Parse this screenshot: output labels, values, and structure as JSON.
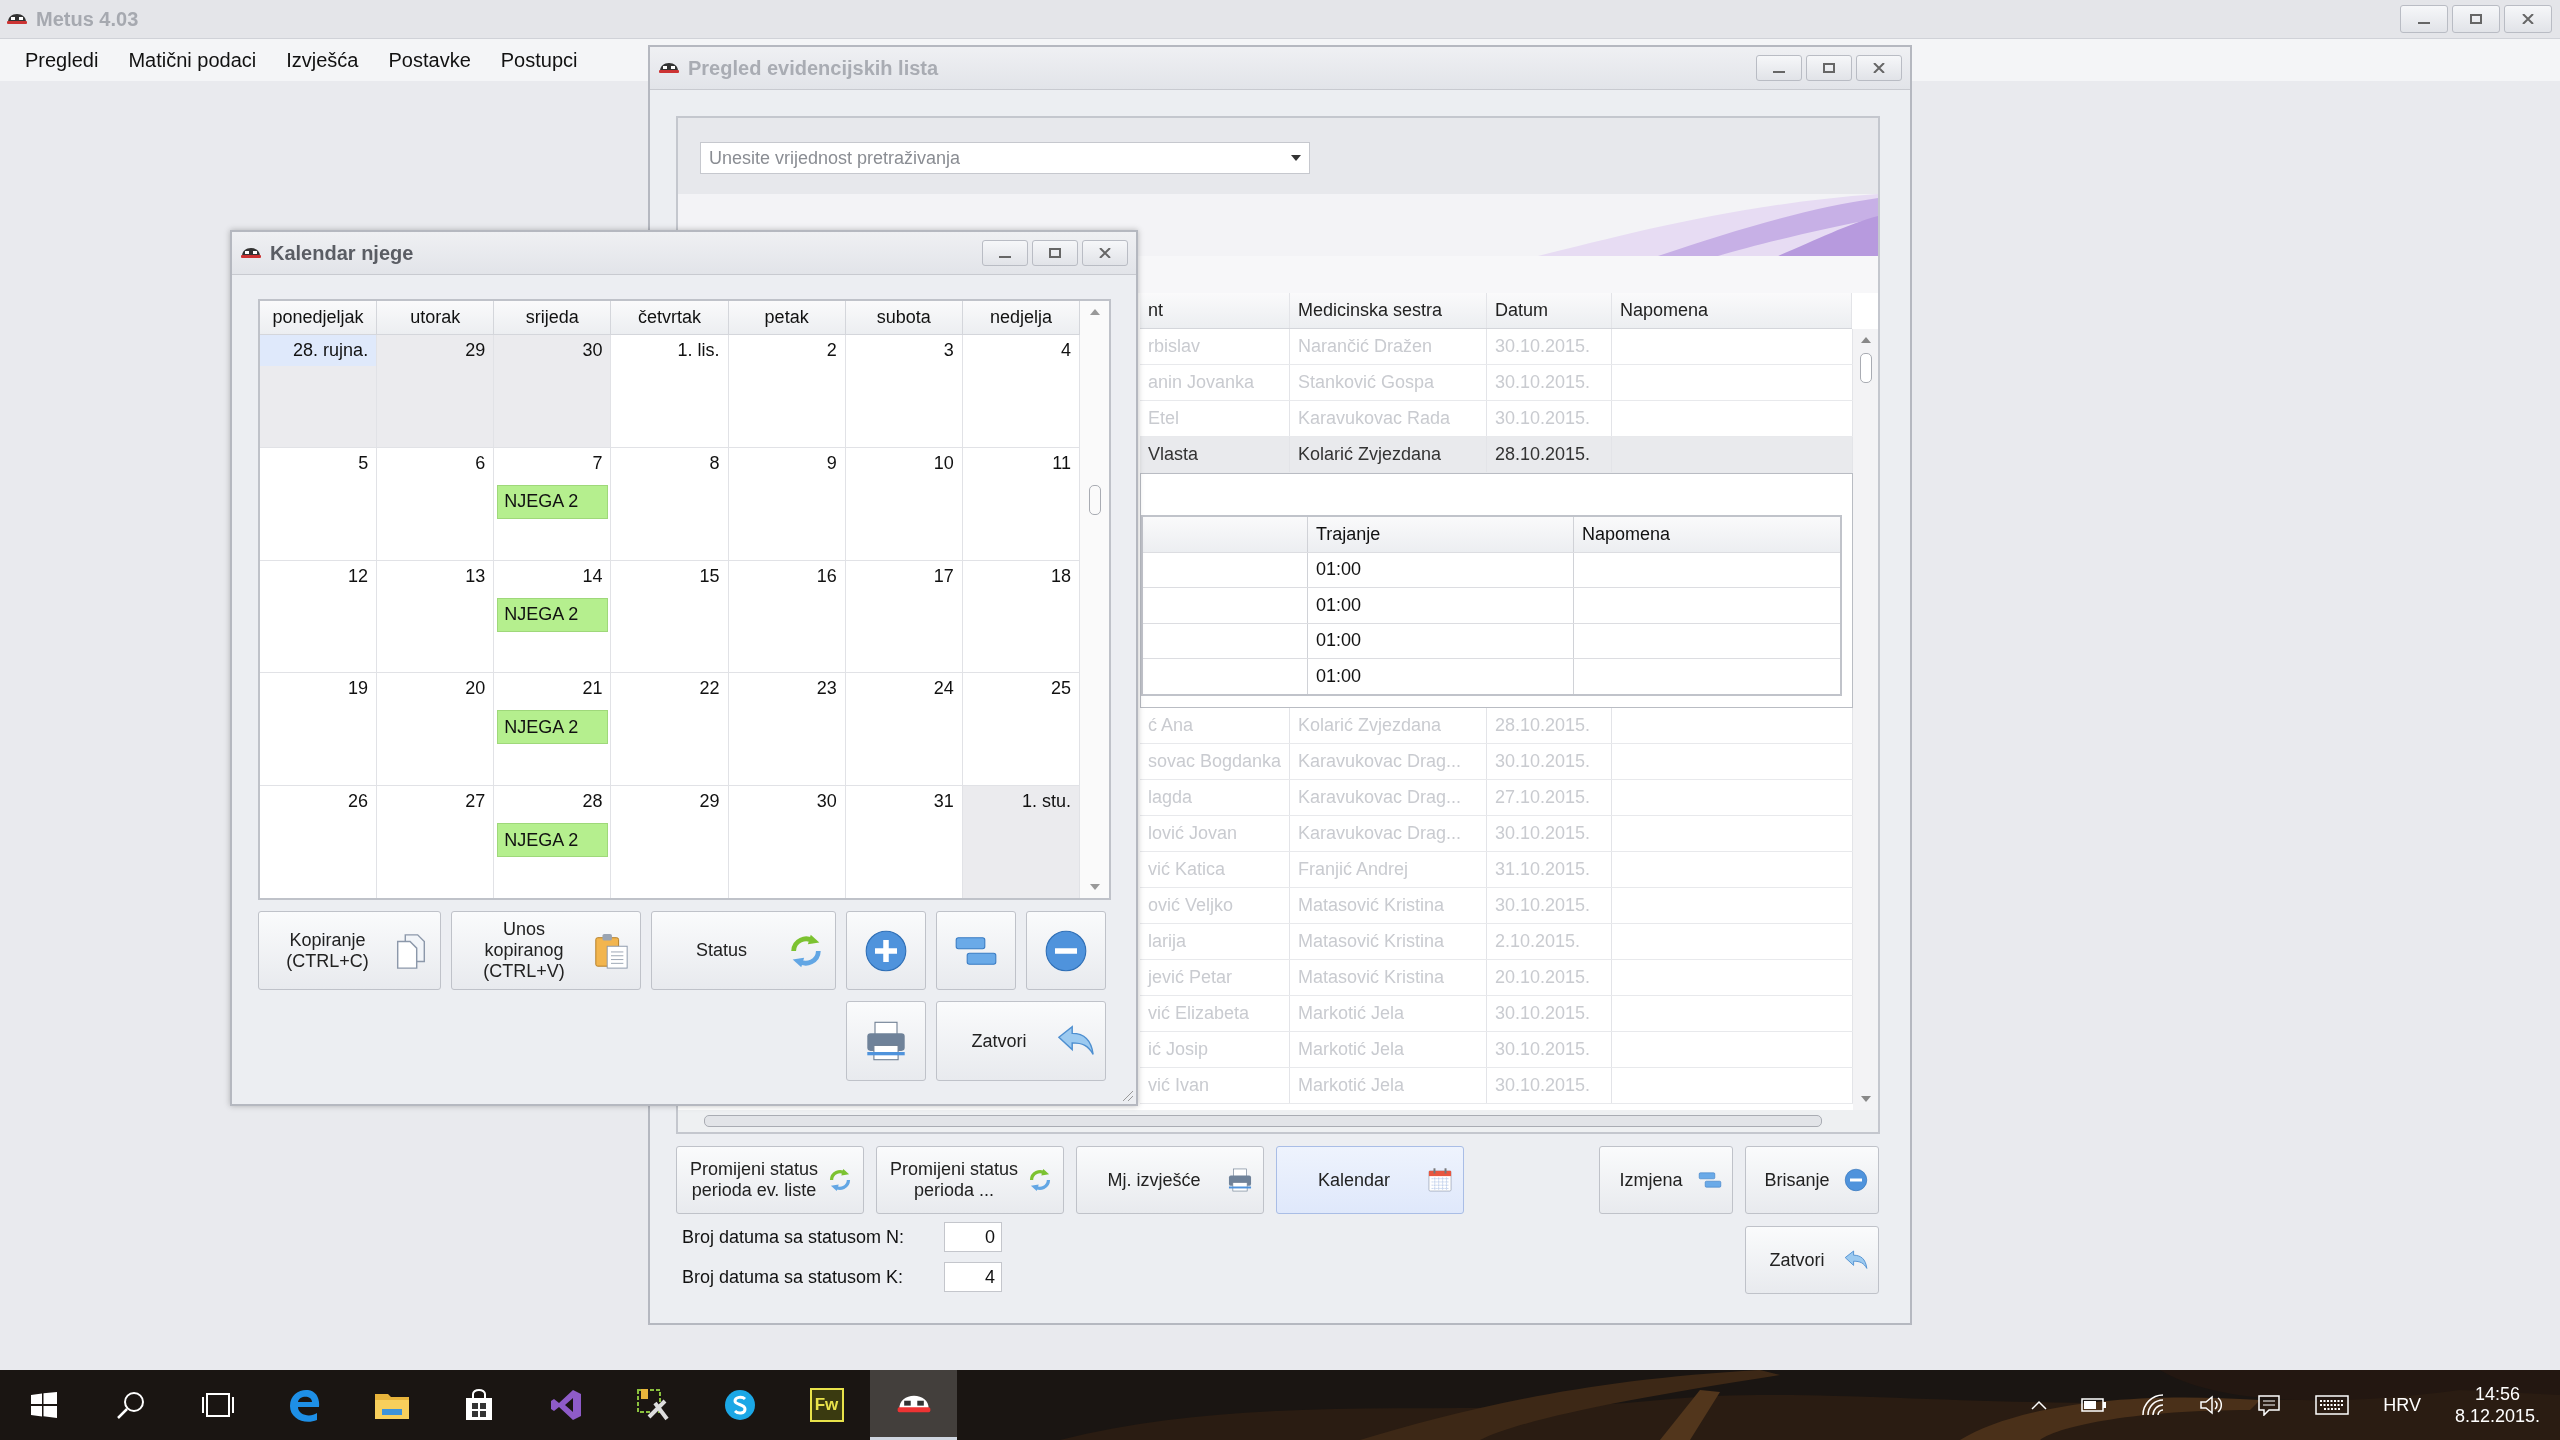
{
  "app": {
    "title": "Metus 4.03",
    "menu": [
      "Pregledi",
      "Matični podaci",
      "Izvješća",
      "Postavke",
      "Postupci"
    ]
  },
  "evidence_window": {
    "title": "Pregled evidencijskih lista",
    "search": {
      "placeholder": "Unesite vrijednost pretraživanja"
    },
    "table": {
      "columns": [
        "nt",
        "Medicinska sestra",
        "Datum",
        "Napomena"
      ],
      "rows": [
        {
          "patient": "rbislav",
          "nurse": "Narančić Dražen",
          "date": "30.10.2015.",
          "selected": false
        },
        {
          "patient": "anin Jovanka",
          "nurse": "Stanković Gospa",
          "date": "30.10.2015.",
          "selected": false
        },
        {
          "patient": "Etel",
          "nurse": "Karavukovac Rada",
          "date": "30.10.2015.",
          "selected": false
        },
        {
          "patient": "Vlasta",
          "nurse": "Kolarić Zvjezdana",
          "date": "28.10.2015.",
          "selected": true,
          "detail": {
            "columns": [
              "Trajanje",
              "Napomena"
            ],
            "rows": [
              {
                "duration": "01:00"
              },
              {
                "duration": "01:00"
              },
              {
                "duration": "01:00"
              },
              {
                "duration": "01:00"
              }
            ]
          }
        },
        {
          "patient": "ć Ana",
          "nurse": "Kolarić Zvjezdana",
          "date": "28.10.2015.",
          "selected": false
        },
        {
          "patient": "sovac Bogdanka",
          "nurse": "Karavukovac Drag...",
          "date": "30.10.2015.",
          "selected": false
        },
        {
          "patient": "lagda",
          "nurse": "Karavukovac Drag...",
          "date": "27.10.2015.",
          "selected": false
        },
        {
          "patient": "lović Jovan",
          "nurse": "Karavukovac Drag...",
          "date": "30.10.2015.",
          "selected": false
        },
        {
          "patient": "vić Katica",
          "nurse": "Franjić Andrej",
          "date": "31.10.2015.",
          "selected": false
        },
        {
          "patient": "ović Veljko",
          "nurse": "Matasović Kristina",
          "date": "30.10.2015.",
          "selected": false
        },
        {
          "patient": "larija",
          "nurse": "Matasović Kristina",
          "date": "2.10.2015.",
          "selected": false
        },
        {
          "patient": "jević Petar",
          "nurse": "Matasović Kristina",
          "date": "20.10.2015.",
          "selected": false
        },
        {
          "patient": "vić Elizabeta",
          "nurse": "Markotić Jela",
          "date": "30.10.2015.",
          "selected": false
        },
        {
          "patient": "ić Josip",
          "nurse": "Markotić Jela",
          "date": "30.10.2015.",
          "selected": false
        },
        {
          "patient": "vić Ivan",
          "nurse": "Markotić Jela",
          "date": "30.10.2015.",
          "selected": false
        }
      ]
    },
    "buttons": [
      {
        "label": "Promijeni status\nperioda ev. liste",
        "kind": "refresh",
        "selected": false
      },
      {
        "label": "Promijeni status\nperioda ...",
        "kind": "refresh",
        "selected": false
      },
      {
        "label": "Mj. izvješće",
        "kind": "print",
        "selected": false
      },
      {
        "label": "Kalendar",
        "kind": "calendar",
        "selected": true
      }
    ],
    "side_buttons": [
      {
        "label": "Izmjena",
        "kind": "edit"
      },
      {
        "label": "Brisanje",
        "kind": "minus"
      }
    ],
    "close_button": {
      "label": "Zatvori",
      "kind": "back"
    },
    "status_fields": [
      {
        "label": "Broj datuma sa statusom N:",
        "value": "0"
      },
      {
        "label": "Broj datuma sa statusom K:",
        "value": "4"
      }
    ]
  },
  "calendar_window": {
    "title": "Kalendar njege",
    "weekdays": [
      "ponedjeljak",
      "utorak",
      "srijeda",
      "četvrtak",
      "petak",
      "subota",
      "nedjelja"
    ],
    "weeks": [
      [
        {
          "date": "28. rujna.",
          "other_month": true,
          "selected": true
        },
        {
          "date": "29",
          "other_month": true,
          "selected": false
        },
        {
          "date": "30",
          "other_month": true,
          "selected": false
        },
        {
          "date": "1. lis.",
          "other_month": false,
          "selected": false
        },
        {
          "date": "2",
          "other_month": false,
          "selected": false
        },
        {
          "date": "3",
          "other_month": false,
          "selected": false
        },
        {
          "date": "4",
          "other_month": false,
          "selected": false
        }
      ],
      [
        {
          "date": "5",
          "other_month": false,
          "selected": false
        },
        {
          "date": "6",
          "other_month": false,
          "selected": false
        },
        {
          "date": "7",
          "other_month": false,
          "selected": false,
          "events": [
            "NJEGA 2"
          ]
        },
        {
          "date": "8",
          "other_month": false,
          "selected": false
        },
        {
          "date": "9",
          "other_month": false,
          "selected": false
        },
        {
          "date": "10",
          "other_month": false,
          "selected": false
        },
        {
          "date": "11",
          "other_month": false,
          "selected": false
        }
      ],
      [
        {
          "date": "12",
          "other_month": false,
          "selected": false
        },
        {
          "date": "13",
          "other_month": false,
          "selected": false
        },
        {
          "date": "14",
          "other_month": false,
          "selected": false,
          "events": [
            "NJEGA 2"
          ]
        },
        {
          "date": "15",
          "other_month": false,
          "selected": false
        },
        {
          "date": "16",
          "other_month": false,
          "selected": false
        },
        {
          "date": "17",
          "other_month": false,
          "selected": false
        },
        {
          "date": "18",
          "other_month": false,
          "selected": false
        }
      ],
      [
        {
          "date": "19",
          "other_month": false,
          "selected": false
        },
        {
          "date": "20",
          "other_month": false,
          "selected": false
        },
        {
          "date": "21",
          "other_month": false,
          "selected": false,
          "events": [
            "NJEGA 2"
          ]
        },
        {
          "date": "22",
          "other_month": false,
          "selected": false
        },
        {
          "date": "23",
          "other_month": false,
          "selected": false
        },
        {
          "date": "24",
          "other_month": false,
          "selected": false
        },
        {
          "date": "25",
          "other_month": false,
          "selected": false
        }
      ],
      [
        {
          "date": "26",
          "other_month": false,
          "selected": false
        },
        {
          "date": "27",
          "other_month": false,
          "selected": false
        },
        {
          "date": "28",
          "other_month": false,
          "selected": false,
          "events": [
            "NJEGA 2"
          ]
        },
        {
          "date": "29",
          "other_month": false,
          "selected": false
        },
        {
          "date": "30",
          "other_month": false,
          "selected": false
        },
        {
          "date": "31",
          "other_month": false,
          "selected": false
        },
        {
          "date": "1. stu.",
          "other_month": true,
          "selected": false
        }
      ]
    ],
    "buttons": [
      {
        "label": "Kopiranje\n(CTRL+C)",
        "kind": "copy"
      },
      {
        "label": "Unos\nkopiranog\n(CTRL+V)",
        "kind": "paste"
      },
      {
        "label": "Status",
        "kind": "refresh"
      },
      {
        "kind": "plus"
      },
      {
        "kind": "edit"
      },
      {
        "kind": "minus"
      },
      {
        "kind": "print"
      },
      {
        "label": "Zatvori",
        "kind": "back"
      }
    ]
  },
  "taskbar": {
    "apps": [
      {
        "kind": "start",
        "selected": false
      },
      {
        "kind": "search",
        "selected": false
      },
      {
        "kind": "taskview",
        "selected": false
      },
      {
        "kind": "browser",
        "selected": false
      },
      {
        "kind": "folder",
        "selected": false
      },
      {
        "kind": "store",
        "selected": false
      },
      {
        "kind": "studio",
        "selected": false
      },
      {
        "kind": "tools",
        "selected": false
      },
      {
        "kind": "chat",
        "selected": false
      },
      {
        "kind": "fw",
        "label": "Fw",
        "selected": false
      },
      {
        "kind": "metus",
        "selected": true
      }
    ],
    "language": "HRV",
    "time": "14:56",
    "date": "8.12.2015."
  }
}
